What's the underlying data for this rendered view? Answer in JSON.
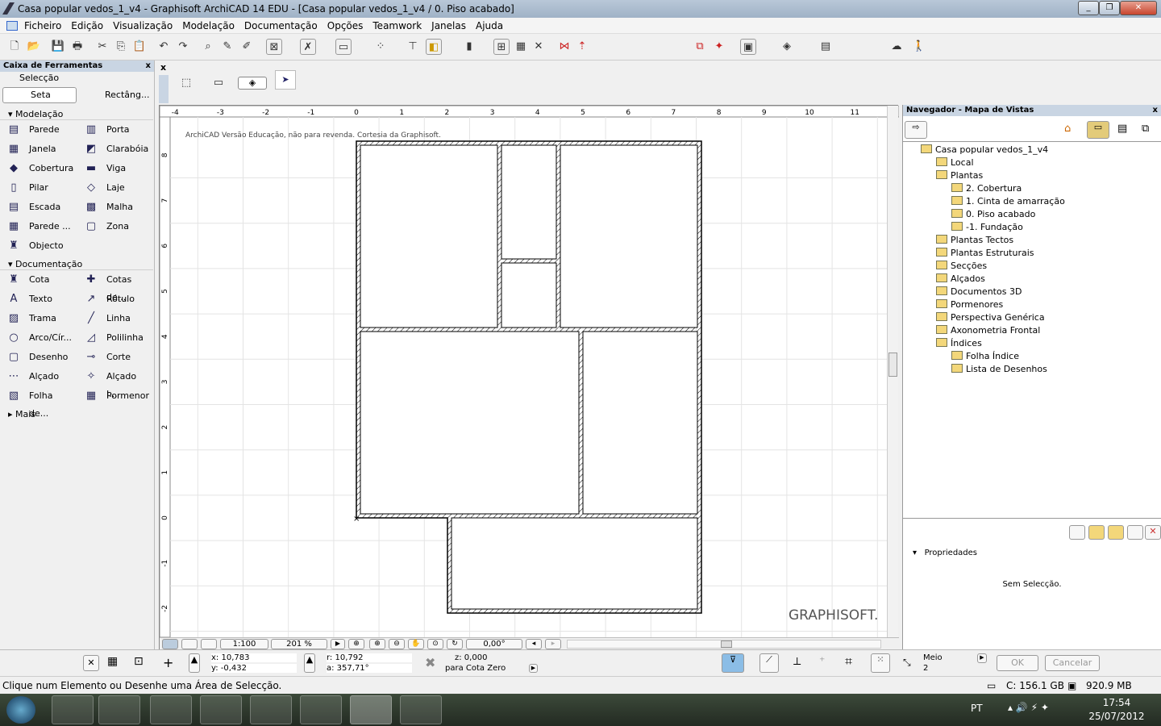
{
  "window": {
    "title": "Casa popular vedos_1_v4 - Graphisoft ArchiCAD 14 EDU - [Casa popular vedos_1_v4 / 0. Piso acabado]"
  },
  "menu": [
    "Ficheiro",
    "Edição",
    "Visualização",
    "Modelação",
    "Documentação",
    "Opções",
    "Teamwork",
    "Janelas",
    "Ajuda"
  ],
  "toolbox": {
    "title": "Caixa de Ferramentas",
    "selection_label": "Selecção",
    "seta": "Seta",
    "rect": "Rectâng...",
    "modelacao": "Modelação",
    "model_tools": [
      "Parede",
      "Porta",
      "Janela",
      "Clarabóia",
      "Cobertura",
      "Viga",
      "Pilar",
      "Laje",
      "Escada",
      "Malha",
      "Parede ...",
      "Zona",
      "Objecto"
    ],
    "documentacao": "Documentação",
    "doc_tools": [
      "Cota",
      "Cotas de...",
      "Texto",
      "Rótulo",
      "Trama",
      "Linha",
      "Arco/Cír...",
      "Polilinha",
      "Desenho",
      "Corte",
      "Alçado",
      "Alçado I...",
      "Folha de...",
      "Pormenor"
    ],
    "mais": "Mais"
  },
  "canvas": {
    "watermark": "ArchiCAD Versão Educação, não para revenda. Cortesia da Graphisoft.",
    "logo": "GRAPHISOFT.",
    "ruler_h": [
      "-4",
      "-3",
      "-2",
      "-1",
      "0",
      "1",
      "2",
      "3",
      "4",
      "5",
      "6",
      "7",
      "8",
      "9",
      "10",
      "11"
    ],
    "ruler_v": [
      "8",
      "7",
      "6",
      "5",
      "4",
      "3",
      "2",
      "1",
      "0",
      "-1",
      "-2"
    ],
    "scale": "1:100",
    "zoom": "201 %",
    "angle": "0,00°"
  },
  "navigator": {
    "title": "Navegador - Mapa de Vistas",
    "tree": [
      {
        "label": "Casa popular vedos_1_v4",
        "level": 0
      },
      {
        "label": "Local",
        "level": 1
      },
      {
        "label": "Plantas",
        "level": 1
      },
      {
        "label": "2. Cobertura",
        "level": 2
      },
      {
        "label": "1. Cinta de amarração",
        "level": 2
      },
      {
        "label": "0. Piso acabado",
        "level": 2
      },
      {
        "label": "-1. Fundação",
        "level": 2
      },
      {
        "label": "Plantas Tectos",
        "level": 1
      },
      {
        "label": "Plantas Estruturais",
        "level": 1
      },
      {
        "label": "Secções",
        "level": 1
      },
      {
        "label": "Alçados",
        "level": 1
      },
      {
        "label": "Documentos 3D",
        "level": 1
      },
      {
        "label": "Pormenores",
        "level": 1
      },
      {
        "label": "Perspectiva Genérica",
        "level": 1
      },
      {
        "label": "Axonometria Frontal",
        "level": 1
      },
      {
        "label": "Índices",
        "level": 1
      },
      {
        "label": "Folha Índice",
        "level": 2
      },
      {
        "label": "Lista de Desenhos",
        "level": 2
      }
    ],
    "properties": "Propriedades",
    "no_selection": "Sem Selecção."
  },
  "coords": {
    "x": "x: 10,783",
    "y": "y: -0,432",
    "r": "r: 10,792",
    "a": "a: 357,71°",
    "z": "z: 0,000",
    "ref": "para Cota Zero"
  },
  "controls": {
    "meio": "Meio",
    "meio_n": "2",
    "ok": "OK",
    "cancel": "Cancelar"
  },
  "status": {
    "hint": "Clique num Elemento ou Desenhe uma Área de Selecção.",
    "disk": "C: 156.1 GB",
    "mem": "920.9 MB"
  },
  "taskbar": {
    "lang": "PT",
    "time": "17:54",
    "date": "25/07/2012"
  }
}
